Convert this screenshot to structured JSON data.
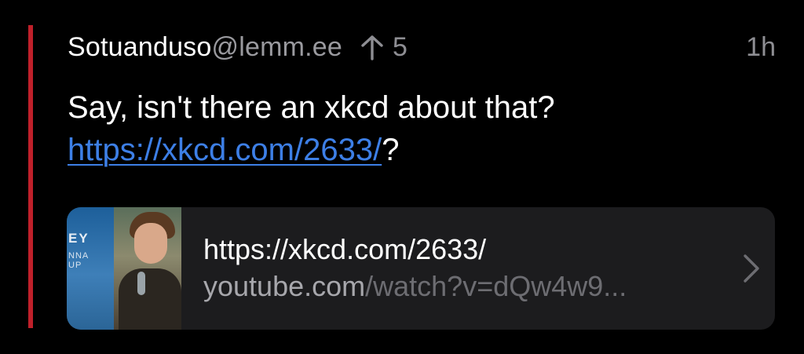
{
  "comment": {
    "author_name": "Sotuanduso",
    "author_instance": "@lemm.ee",
    "score": "5",
    "timestamp": "1h",
    "body_text": "Say, isn't there an xkcd about that?",
    "body_link": "https://xkcd.com/2633/",
    "body_suffix": "?"
  },
  "link_card": {
    "title": "https://xkcd.com/2633/",
    "domain": "youtube.com",
    "path": "/watch?v=dQw4w9...",
    "thumbnail_text_1": "EY",
    "thumbnail_text_2": "NNA\nUP"
  },
  "colors": {
    "thread_line": "#c0202a",
    "link": "#3d7fe6",
    "card_bg": "#1c1c1e",
    "muted": "#8e8e93"
  },
  "icons": {
    "upvote": "arrow-up-icon",
    "chevron": "chevron-right-icon"
  }
}
